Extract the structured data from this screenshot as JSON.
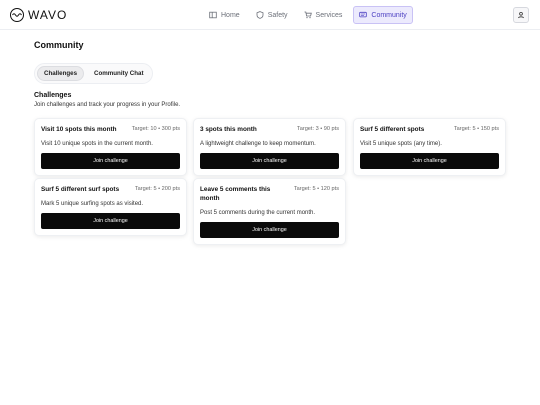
{
  "brand": {
    "name": "WAVO"
  },
  "nav": [
    {
      "label": "Home",
      "icon": "home-icon"
    },
    {
      "label": "Safety",
      "icon": "shield-icon"
    },
    {
      "label": "Services",
      "icon": "cart-icon"
    },
    {
      "label": "Community",
      "icon": "chat-icon",
      "active": true
    }
  ],
  "page": {
    "title": "Community"
  },
  "tabs": [
    {
      "label": "Challenges",
      "active": true
    },
    {
      "label": "Community Chat",
      "active": false
    }
  ],
  "challenges": {
    "title": "Challenges",
    "description": "Join challenges and track your progress in your Profile.",
    "button_label": "Join challenge",
    "cards": [
      {
        "title": "Visit 10 spots this month",
        "target": "Target: 10 • 300 pts",
        "description": "Visit 10 unique spots in the current month."
      },
      {
        "title": "3 spots this month",
        "target": "Target: 3 • 90 pts",
        "description": "A lightweight challenge to keep momentum."
      },
      {
        "title": "Surf 5 different spots",
        "target": "Target: 5 • 150 pts",
        "description": "Visit 5 unique spots (any time)."
      },
      {
        "title": "Surf 5 different surf spots",
        "target": "Target: 5 • 200 pts",
        "description": "Mark 5 unique surfing spots as visited."
      },
      {
        "title": "Leave 5 comments this month",
        "target": "Target: 5 • 120 pts",
        "description": "Post 5 comments during the current month."
      }
    ]
  },
  "colors": {
    "accent": "#4b3fc2",
    "accent_bg": "#eceafd",
    "button": "#0a0a0a"
  }
}
